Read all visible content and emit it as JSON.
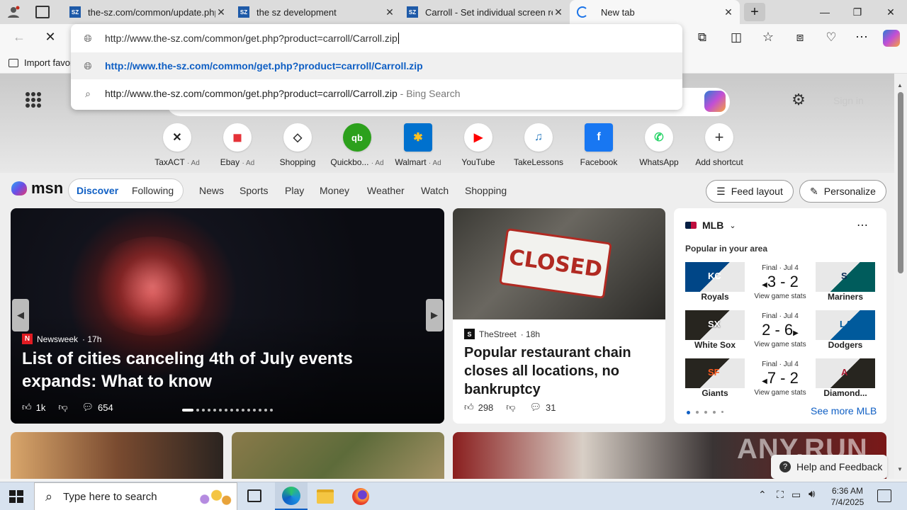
{
  "tabs": [
    {
      "favicon": "SZ",
      "title": "the-sz.com/common/update.php"
    },
    {
      "favicon": "SZ",
      "title": "the sz development"
    },
    {
      "favicon": "SZ",
      "title": "Carroll - Set individual screen reso"
    },
    {
      "favicon": "loading",
      "title": "New tab"
    }
  ],
  "address": {
    "value": "http://www.the-sz.com/common/get.php?product=carroll/Carroll.zip",
    "suggestion_url": "http://www.the-sz.com/common/get.php?product=carroll/Carroll.zip",
    "suggestion_search": "http://www.the-sz.com/common/get.php?product=carroll/Carroll.zip",
    "suggestion_search_suffix": " - Bing Search"
  },
  "favbar": {
    "import_label": "Import favor"
  },
  "page": {
    "sign_in": "Sign in",
    "shortcuts": [
      {
        "label": "TaxACT",
        "ad": "· Ad",
        "glyph": "✕",
        "color": "#222"
      },
      {
        "label": "Ebay",
        "ad": "· Ad",
        "glyph": "◼",
        "color": "#e53238"
      },
      {
        "label": "Shopping",
        "ad": "",
        "glyph": "◇",
        "color": "#333"
      },
      {
        "label": "Quickbo...",
        "ad": "· Ad",
        "glyph": "qb",
        "color": "#2ca01c"
      },
      {
        "label": "Walmart",
        "ad": "· Ad",
        "glyph": "✱",
        "color": "#0071ce"
      },
      {
        "label": "YouTube",
        "ad": "",
        "glyph": "▶",
        "color": "#ff0000"
      },
      {
        "label": "TakeLessons",
        "ad": "",
        "glyph": "♫",
        "color": "#2a7bbf"
      },
      {
        "label": "Facebook",
        "ad": "",
        "glyph": "f",
        "color": "#1877f2"
      },
      {
        "label": "WhatsApp",
        "ad": "",
        "glyph": "✆",
        "color": "#25d366"
      },
      {
        "label": "Add shortcut",
        "ad": "",
        "glyph": "+",
        "color": "#333"
      }
    ],
    "brand": "msn",
    "nav_toggle": [
      "Discover",
      "Following"
    ],
    "nav": [
      "News",
      "Sports",
      "Play",
      "Money",
      "Weather",
      "Watch",
      "Shopping"
    ],
    "feed_layout": "Feed layout",
    "personalize": "Personalize",
    "hero": {
      "source": "Newsweek",
      "time": "· 17h",
      "title": "List of cities canceling 4th of July events expands: What to know",
      "likes": "1k",
      "comments": "654"
    },
    "story": {
      "source": "TheStreet",
      "time": "· 18h",
      "title": "Popular restaurant chain closes all locations, no bankruptcy",
      "likes": "298",
      "comments": "31",
      "sign_text": "CLOSED"
    },
    "mlb": {
      "title": "MLB",
      "subtitle": "Popular in your area",
      "see_more": "See more MLB",
      "games": [
        {
          "status": "Final · Jul 4",
          "score": "3 - 2",
          "stats": "View game stats",
          "home": "Royals",
          "away": "Mariners",
          "home_abbr": "KC",
          "away_abbr": "S",
          "home_color": "#004687",
          "away_color": "#0c2c56"
        },
        {
          "status": "Final · Jul 4",
          "score": "2 - 6",
          "stats": "View game stats",
          "home": "White Sox",
          "away": "Dodgers",
          "home_abbr": "SX",
          "away_abbr": "LA",
          "home_color": "#27251f",
          "away_color": "#005a9c"
        },
        {
          "status": "Final · Jul 4",
          "score": "7 - 2",
          "stats": "View game stats",
          "home": "Giants",
          "away": "Diamond...",
          "home_abbr": "SF",
          "away_abbr": "A",
          "home_color": "#fd5a1e",
          "away_color": "#a71930"
        }
      ]
    },
    "feedback": "Help and Feedback",
    "watermark": "ANY.RUN"
  },
  "taskbar": {
    "search_placeholder": "Type here to search",
    "time": "6:36 AM",
    "date": "7/4/2025"
  }
}
